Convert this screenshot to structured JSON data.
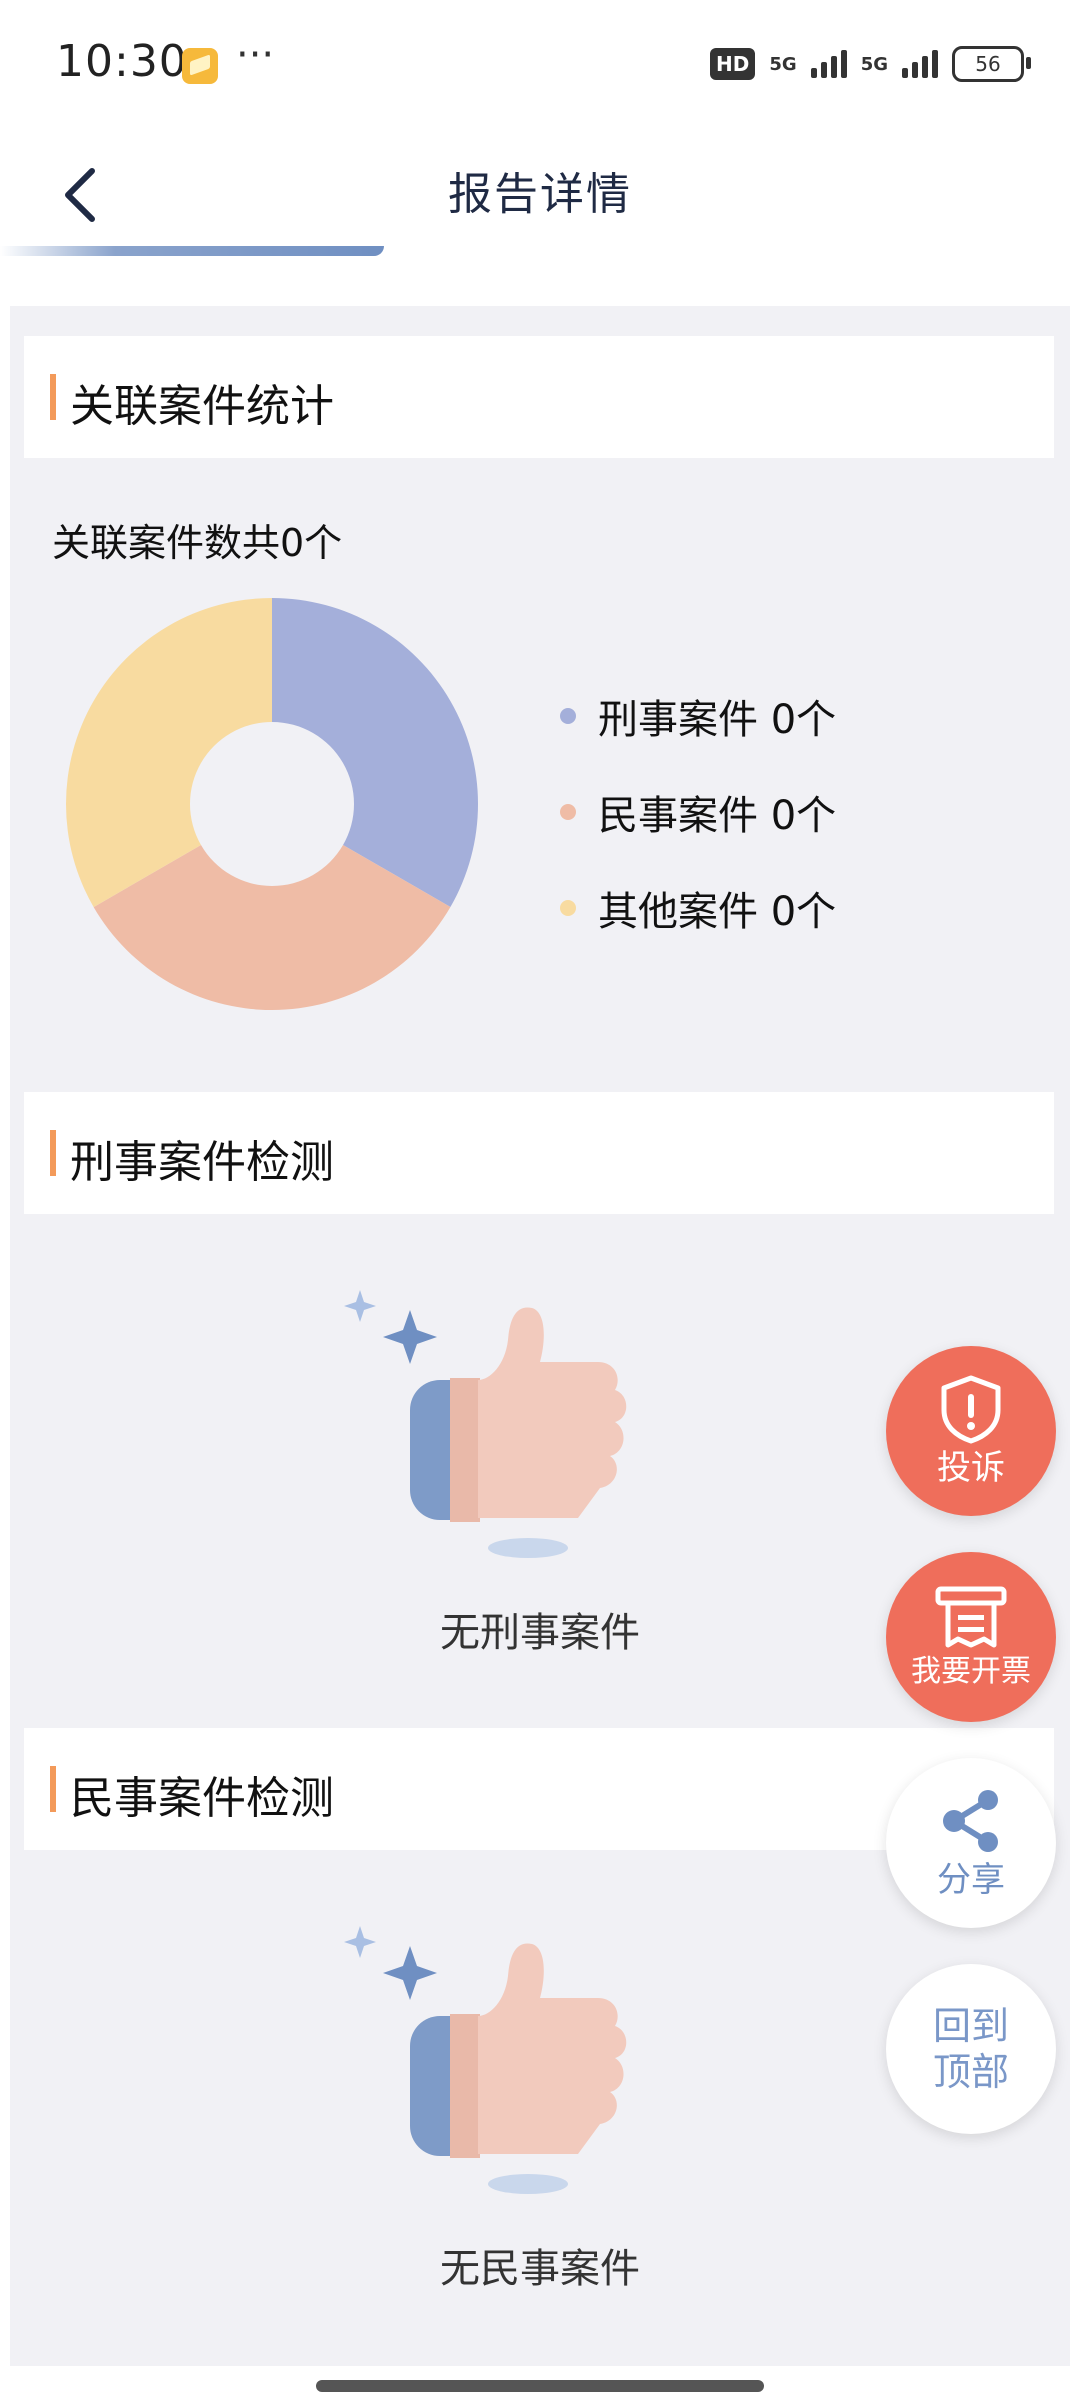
{
  "status_bar": {
    "time": "10:30",
    "more": "···",
    "hd": "HD",
    "net1": "5G",
    "net2": "5G",
    "battery": "56"
  },
  "header": {
    "title": "报告详情",
    "back_icon": "chevron-left-icon"
  },
  "sections": {
    "stats": {
      "title": "关联案件统计",
      "total_text": "关联案件数共0个"
    },
    "criminal": {
      "title": "刑事案件检测",
      "empty_text": "无刑事案件"
    },
    "civil": {
      "title": "民事案件检测",
      "empty_text": "无民事案件"
    }
  },
  "chart_data": {
    "type": "pie",
    "donut": true,
    "categories": [
      "刑事案件",
      "民事案件",
      "其他案件"
    ],
    "values": [
      0,
      0,
      0
    ],
    "display_shares": [
      0.3333,
      0.3333,
      0.3334
    ],
    "colors": [
      "#a4afda",
      "#efbca6",
      "#f8dba0"
    ],
    "legend_labels": [
      "刑事案件 0个",
      "民事案件 0个",
      "其他案件 0个"
    ],
    "legend_placement": "right"
  },
  "fabs": {
    "complaint": {
      "label": "投诉",
      "icon": "shield-alert-icon"
    },
    "invoice": {
      "label": "我要开票",
      "icon": "receipt-icon"
    },
    "share": {
      "label": "分享",
      "icon": "share-icon"
    },
    "top": {
      "line1": "回到",
      "line2": "顶部"
    }
  }
}
